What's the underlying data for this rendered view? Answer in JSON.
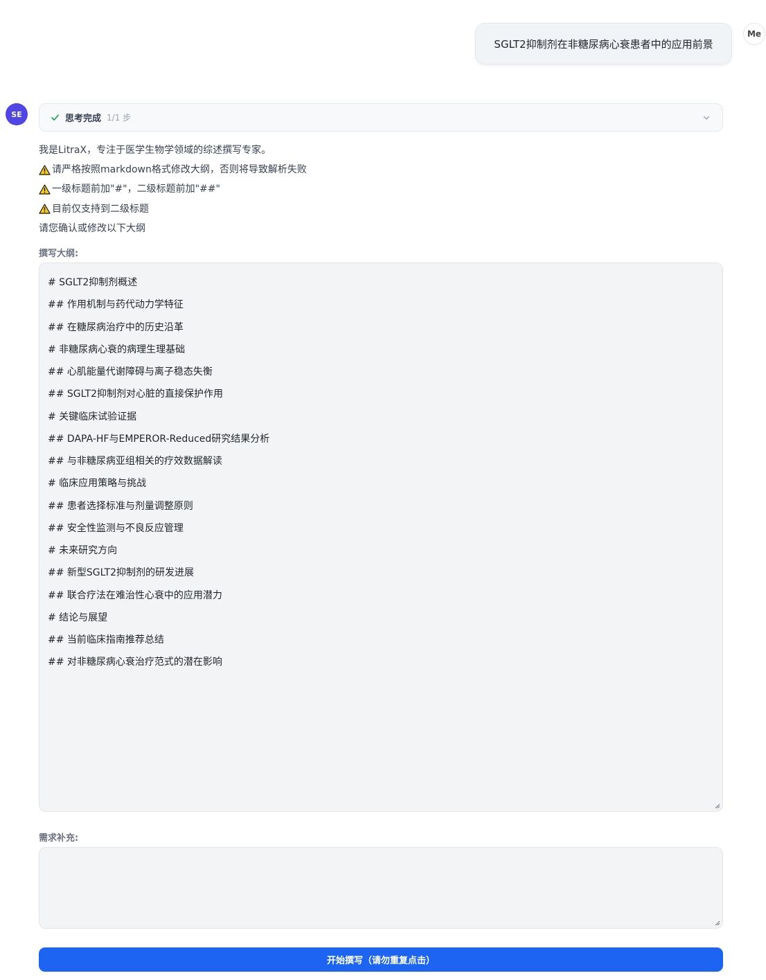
{
  "user": {
    "avatar_label": "Me",
    "message": "SGLT2抑制剂在非糖尿病心衰患者中的应用前景"
  },
  "assistant": {
    "avatar_label": "SE",
    "thinking": {
      "label": "思考完成",
      "steps": "1/1 步"
    },
    "intro_lines": [
      {
        "text": "我是LitraX，专注于医学生物学领域的综述撰写专家。",
        "icon": null
      },
      {
        "text": "请严格按照markdown格式修改大纲，否则将导致解析失败",
        "icon": "warning-icon"
      },
      {
        "text": "一级标题前加\"#\"，二级标题前加\"##\"",
        "icon": "warning-icon"
      },
      {
        "text": "目前仅支持到二级标题",
        "icon": "warning-icon"
      },
      {
        "text": "请您确认或修改以下大纲",
        "icon": null
      }
    ],
    "outline_label": "撰写大纲:",
    "outline_lines": [
      "# SGLT2抑制剂概述",
      "## 作用机制与药代动力学特征",
      "## 在糖尿病治疗中的历史沿革",
      "# 非糖尿病心衰的病理生理基础",
      "## 心肌能量代谢障碍与离子稳态失衡",
      "## SGLT2抑制剂对心脏的直接保护作用",
      "# 关键临床试验证据",
      "## DAPA-HF与EMPEROR-Reduced研究结果分析",
      "## 与非糖尿病亚组相关的疗效数据解读",
      "# 临床应用策略与挑战",
      "## 患者选择标准与剂量调整原则",
      "## 安全性监测与不良反应管理",
      "# 未来研究方向",
      "## 新型SGLT2抑制剂的研发进展",
      "## 联合疗法在难治性心衰中的应用潜力",
      "# 结论与展望",
      "## 当前临床指南推荐总结",
      "## 对非糖尿病心衰治疗范式的潜在影响"
    ],
    "supplement_label": "需求补充:",
    "supplement_value": "",
    "submit_label": "开始撰写（请勿重复点击）"
  },
  "colors": {
    "accent": "#1d64f2",
    "assistant_avatar": "#4f46e5",
    "check": "#16a34a",
    "warning": "#facc15"
  }
}
